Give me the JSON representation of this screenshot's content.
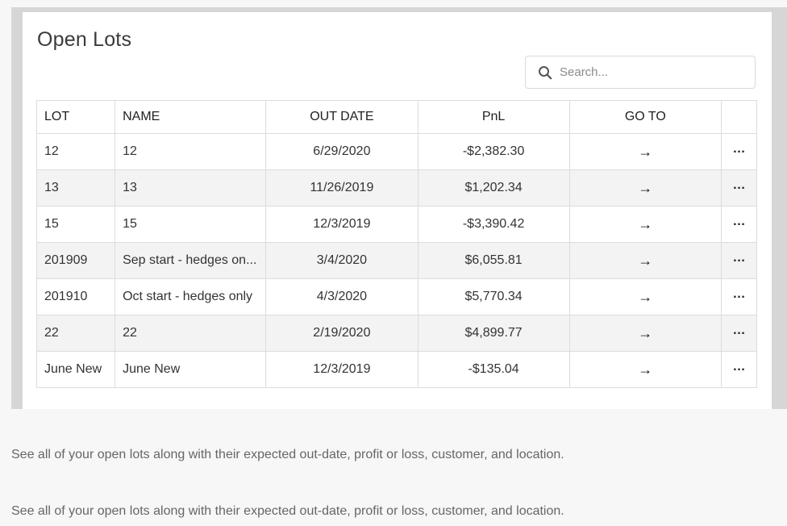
{
  "panel": {
    "title": "Open Lots",
    "search": {
      "placeholder": "Search...",
      "value": ""
    }
  },
  "table": {
    "headers": {
      "lot": "LOT",
      "name": "NAME",
      "out_date": "OUT DATE",
      "pnl": "PnL",
      "go_to": "GO TO"
    },
    "rows": [
      {
        "lot": "12",
        "name": "12",
        "out_date": "6/29/2020",
        "pnl": "-$2,382.30",
        "go_icon": "arrow-right-icon",
        "more_icon": "more-horizontal-icon"
      },
      {
        "lot": "13",
        "name": "13",
        "out_date": "11/26/2019",
        "pnl": "$1,202.34",
        "go_icon": "arrow-right-icon",
        "more_icon": "more-horizontal-icon"
      },
      {
        "lot": "15",
        "name": "15",
        "out_date": "12/3/2019",
        "pnl": "-$3,390.42",
        "go_icon": "arrow-right-icon",
        "more_icon": "more-horizontal-icon"
      },
      {
        "lot": "201909",
        "name": "Sep start - hedges on...",
        "out_date": "3/4/2020",
        "pnl": "$6,055.81",
        "go_icon": "arrow-right-icon",
        "more_icon": "more-horizontal-icon"
      },
      {
        "lot": "201910",
        "name": "Oct start - hedges only",
        "out_date": "4/3/2020",
        "pnl": "$5,770.34",
        "go_icon": "arrow-right-icon",
        "more_icon": "more-horizontal-icon"
      },
      {
        "lot": "22",
        "name": "22",
        "out_date": "2/19/2020",
        "pnl": "$4,899.77",
        "go_icon": "arrow-right-icon",
        "more_icon": "more-horizontal-icon"
      },
      {
        "lot": "June New",
        "name": "June New",
        "out_date": "12/3/2019",
        "pnl": "-$135.04",
        "go_icon": "arrow-right-icon",
        "more_icon": "more-horizontal-icon"
      }
    ]
  },
  "descriptions": [
    "See all of your open lots along with their expected out-date, profit or loss, customer, and location.",
    "See all of your open lots along with their expected out-date, profit or loss, customer, and location."
  ],
  "colors": {
    "page_background": "#f7f7f7",
    "frame": "#d6d6d6",
    "card": "#ffffff",
    "alt_row": "#f3f3f3",
    "border": "#dcdcdc"
  }
}
